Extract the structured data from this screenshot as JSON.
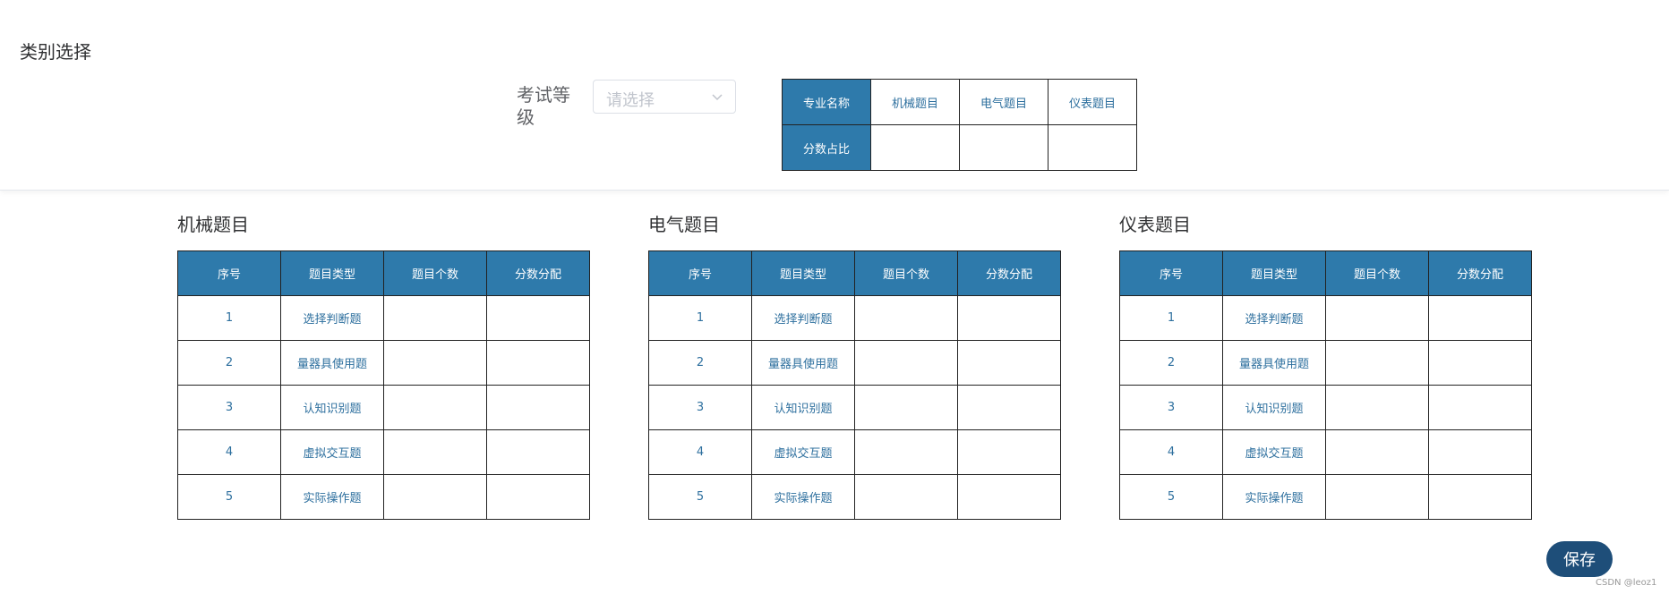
{
  "category": {
    "title": "类别选择"
  },
  "exam_level": {
    "label": "考试等级",
    "placeholder": "请选择"
  },
  "ratio_table": {
    "header_label": "专业名称",
    "row_label": "分数占比",
    "columns": [
      "机械题目",
      "电气题目",
      "仪表题目"
    ]
  },
  "sections": [
    {
      "title": "机械题目",
      "headers": [
        "序号",
        "题目类型",
        "题目个数",
        "分数分配"
      ],
      "rows": [
        {
          "no": "1",
          "type": "选择判断题"
        },
        {
          "no": "2",
          "type": "量器具使用题"
        },
        {
          "no": "3",
          "type": "认知识别题"
        },
        {
          "no": "4",
          "type": "虚拟交互题"
        },
        {
          "no": "5",
          "type": "实际操作题"
        }
      ]
    },
    {
      "title": "电气题目",
      "headers": [
        "序号",
        "题目类型",
        "题目个数",
        "分数分配"
      ],
      "rows": [
        {
          "no": "1",
          "type": "选择判断题"
        },
        {
          "no": "2",
          "type": "量器具使用题"
        },
        {
          "no": "3",
          "type": "认知识别题"
        },
        {
          "no": "4",
          "type": "虚拟交互题"
        },
        {
          "no": "5",
          "type": "实际操作题"
        }
      ]
    },
    {
      "title": "仪表题目",
      "headers": [
        "序号",
        "题目类型",
        "题目个数",
        "分数分配"
      ],
      "rows": [
        {
          "no": "1",
          "type": "选择判断题"
        },
        {
          "no": "2",
          "type": "量器具使用题"
        },
        {
          "no": "3",
          "type": "认知识别题"
        },
        {
          "no": "4",
          "type": "虚拟交互题"
        },
        {
          "no": "5",
          "type": "实际操作题"
        }
      ]
    }
  ],
  "actions": {
    "save_label": "保存"
  },
  "watermark": "CSDN @leoz1",
  "colors": {
    "header_bg": "#2e7aab",
    "cell_text": "#2d6f9e",
    "save_bg": "#1e4e79"
  }
}
